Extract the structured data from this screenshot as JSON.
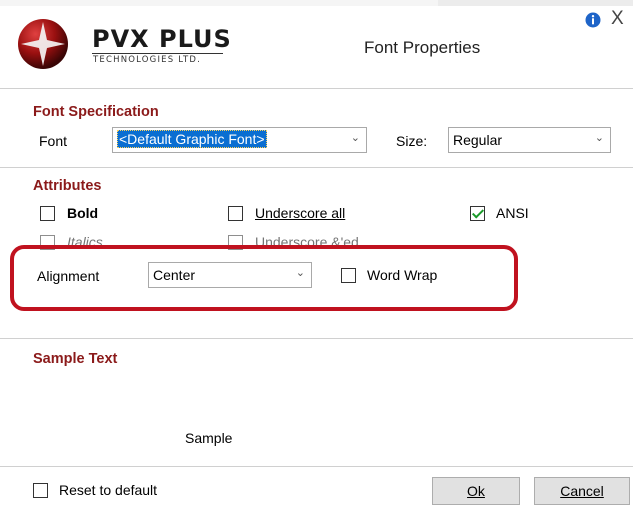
{
  "header": {
    "brand_name": "PVX PLUS",
    "brand_sub": "TECHNOLOGIES LTD.",
    "title": "Font Properties",
    "close_glyph": "X",
    "info_icon": "info-icon",
    "close_icon": "close-icon",
    "logo_icon": "pvx-logo-icon"
  },
  "font_spec": {
    "title": "Font Specification",
    "font_label": "Font",
    "font_value": "<Default Graphic Font>",
    "size_label": "Size:",
    "size_value": "Regular"
  },
  "attributes": {
    "title": "Attributes",
    "bold_label": "Bold",
    "bold_checked": false,
    "italics_label": "Italics",
    "italics_checked": false,
    "underscore_all_label": "Underscore all",
    "underscore_all_checked": false,
    "underscore_ed_label": "Underscore &'ed",
    "underscore_ed_checked": false,
    "ansi_label": "ANSI",
    "ansi_checked": true,
    "alignment_label": "Alignment",
    "alignment_value": "Center",
    "wordwrap_label": "Word Wrap",
    "wordwrap_checked": false
  },
  "sample": {
    "title": "Sample Text",
    "text": "Sample"
  },
  "footer": {
    "reset_label": "Reset to default",
    "reset_checked": false,
    "ok_label": "Ok",
    "cancel_label": "Cancel"
  },
  "colors": {
    "section_title": "#8b1a1a",
    "highlight_ring": "#c0121f",
    "check_mark": "#1a9a2a",
    "font_selection": "#0a6ed1"
  }
}
